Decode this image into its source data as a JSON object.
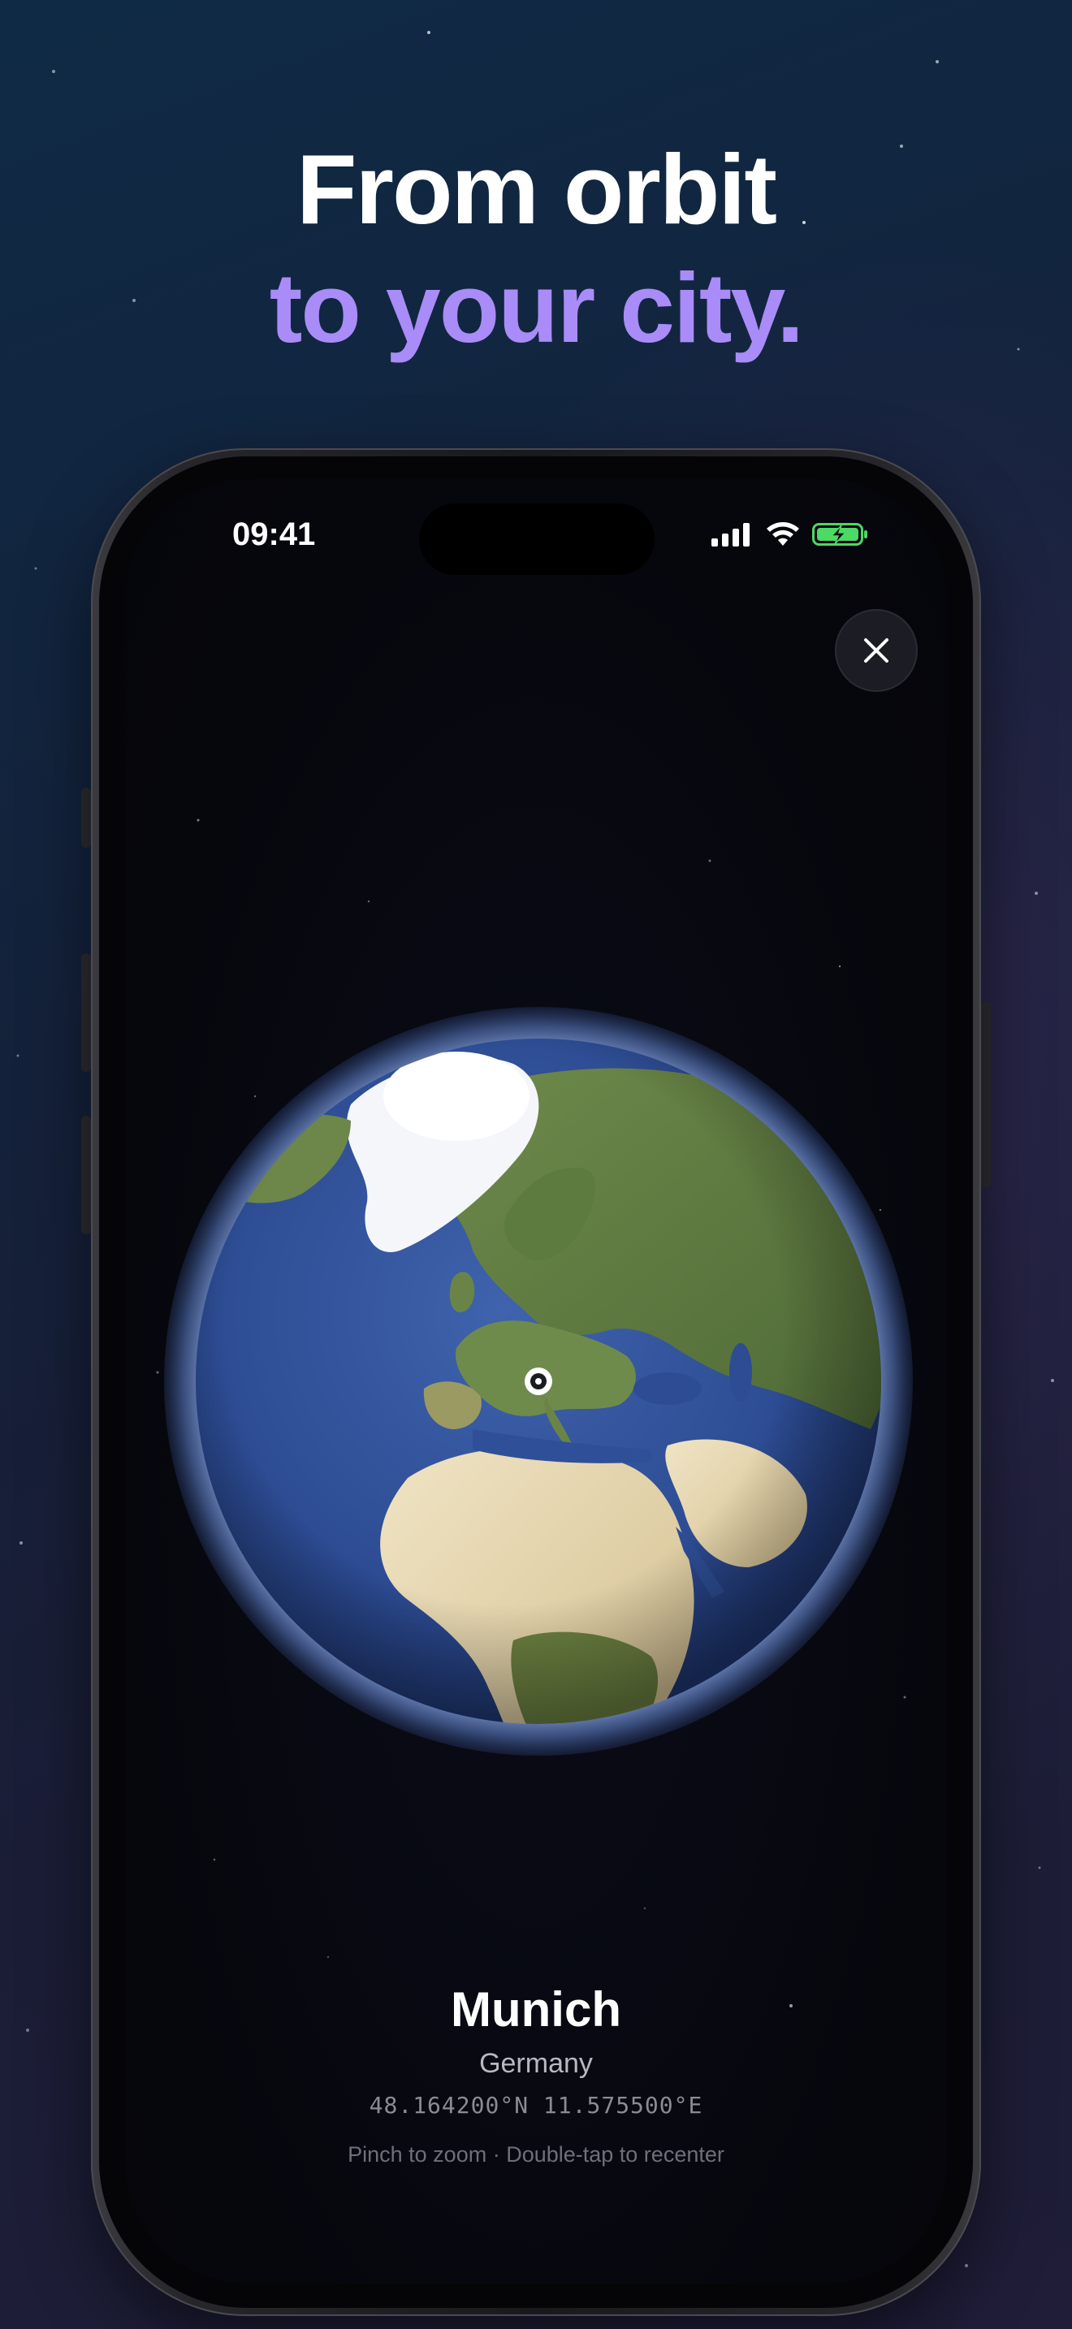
{
  "headline": {
    "line1": "From orbit",
    "line2": "to your city."
  },
  "status_bar": {
    "time": "09:41",
    "icons": [
      "signal-icon",
      "wifi-icon",
      "battery-charging-icon"
    ]
  },
  "close_button": {
    "icon": "close-icon"
  },
  "location": {
    "city": "Munich",
    "country": "Germany",
    "coordinates": "48.164200°N 11.575500°E"
  },
  "hint": "Pinch to zoom · Double-tap to recenter",
  "colors": {
    "accent": "#a98cf7",
    "headline": "#ffffff",
    "battery": "#4cd964",
    "ocean": "#2f4f94",
    "background": "#14213a"
  }
}
